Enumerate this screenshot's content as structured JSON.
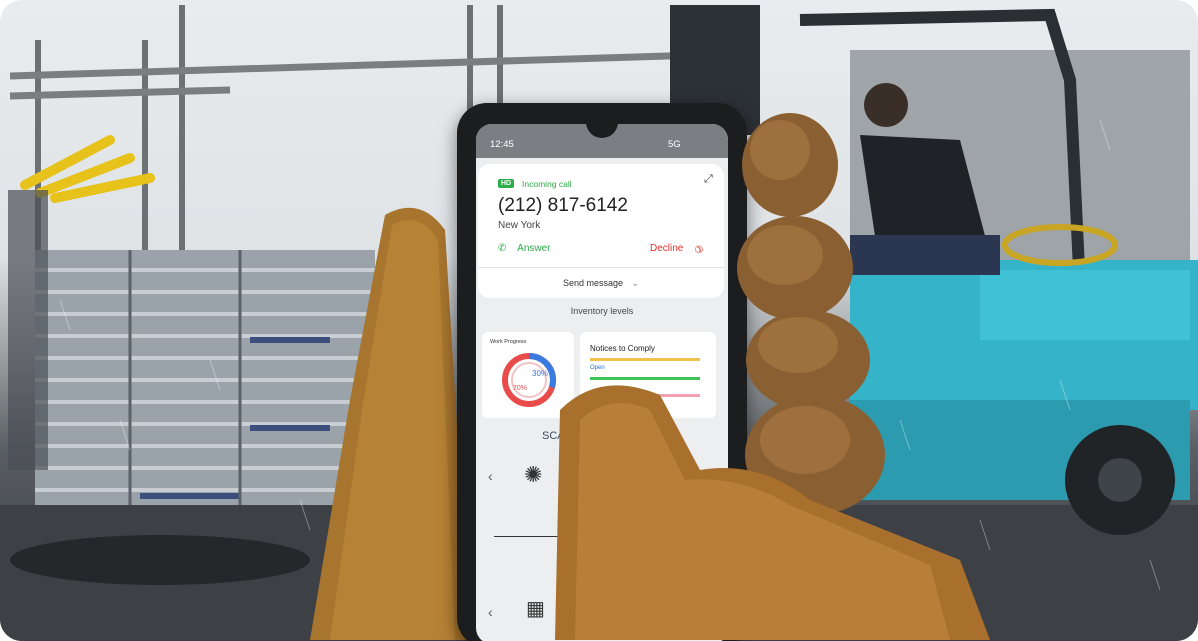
{
  "status_bar": {
    "time": "12:45",
    "network": "5G"
  },
  "call": {
    "badge": "HD",
    "status": "Incoming call",
    "number": "(212) 817-6142",
    "location": "New York",
    "answer_label": "Answer",
    "decline_label": "Decline",
    "send_message_label": "Send message"
  },
  "app": {
    "section_title": "Inventory levels",
    "work_progress": {
      "title": "Work Progress",
      "inner_label": "30%",
      "outer_label": "70%",
      "inner_value": 30,
      "outer_value": 70
    },
    "notices": {
      "title": "Notices to Comply",
      "open_label": "Open"
    },
    "scan_label": "SCA"
  }
}
